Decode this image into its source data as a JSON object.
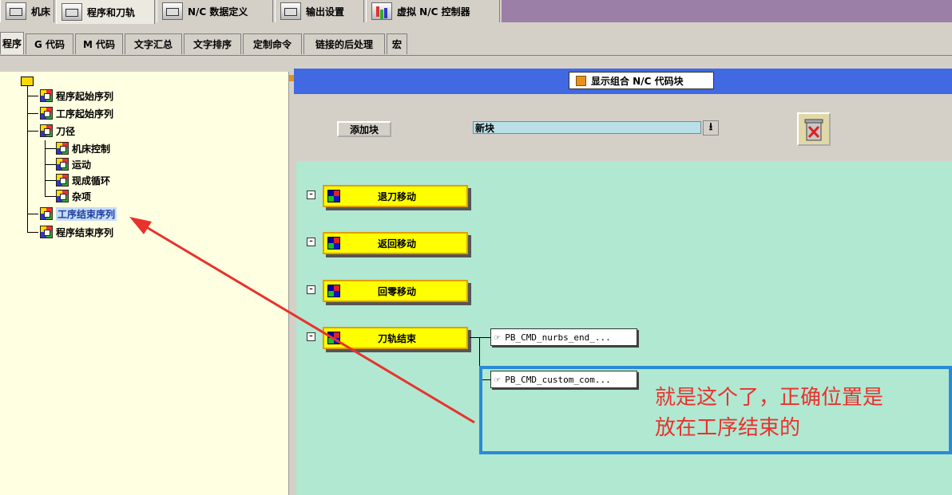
{
  "top_tabs": [
    {
      "label": "机床",
      "icon": "machine-icon"
    },
    {
      "label": "程序和刀轨",
      "icon": "program-toolpath-icon",
      "active": true
    },
    {
      "label": "N/C 数据定义",
      "icon": "nc-data-icon"
    },
    {
      "label": "输出设置",
      "icon": "printer-icon"
    },
    {
      "label": "虚拟 N/C 控制器",
      "icon": "chart-icon"
    }
  ],
  "sub_tabs": [
    {
      "label": "程序",
      "active": true
    },
    {
      "label": "G 代码"
    },
    {
      "label": "M 代码"
    },
    {
      "label": "文字汇总"
    },
    {
      "label": "文字排序"
    },
    {
      "label": "定制命令"
    },
    {
      "label": "链接的后处理"
    },
    {
      "label": "宏"
    }
  ],
  "tree": {
    "items": [
      {
        "label": "程序起始序列"
      },
      {
        "label": "工序起始序列"
      },
      {
        "label": "刀径"
      },
      {
        "label": "机床控制"
      },
      {
        "label": "运动"
      },
      {
        "label": "现成循环"
      },
      {
        "label": "杂项"
      },
      {
        "label": "工序结束序列",
        "selected": true
      },
      {
        "label": "程序结束序列"
      }
    ]
  },
  "panel": {
    "header_label": "显示组合 N/C 代码块",
    "add_button": "添加块",
    "block_select_value": "新块",
    "blocks": [
      {
        "label": "退刀移动"
      },
      {
        "label": "返回移动"
      },
      {
        "label": "回零移动"
      },
      {
        "label": "刀轨结束"
      }
    ],
    "commands": [
      {
        "label": "PB_CMD_nurbs_end_..."
      },
      {
        "label": "PB_CMD_custom_com..."
      }
    ]
  },
  "annotation": {
    "text_line1": "就是这个了，正确位置是",
    "text_line2": "放在工序结束的"
  },
  "colors": {
    "header_blue": "#4169e1",
    "canvas_green": "#b0e8d2",
    "block_yellow": "#ffff00",
    "tree_bg": "#ffffe1",
    "annotation_red": "#e8322d",
    "annotation_box_blue": "#2a8ad8"
  }
}
